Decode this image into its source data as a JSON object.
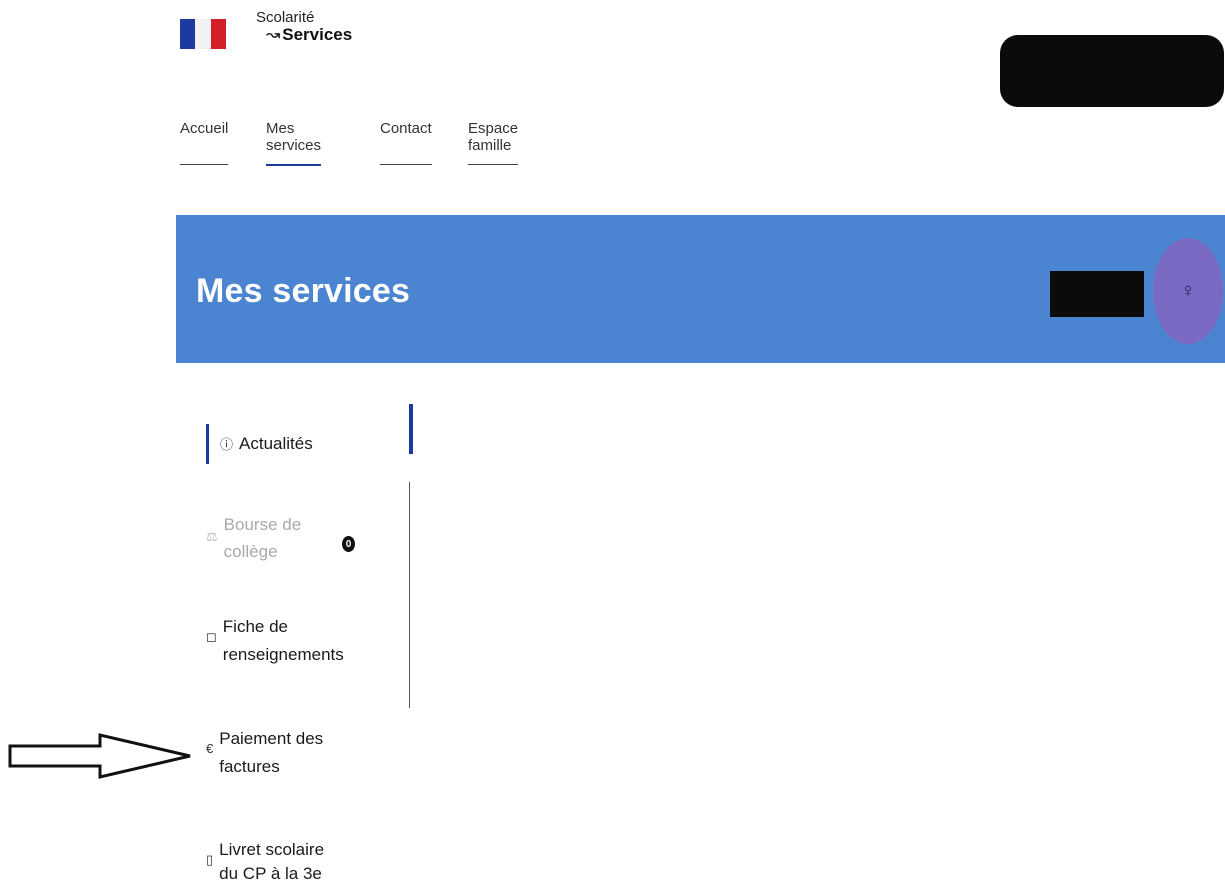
{
  "header": {
    "brand_line1": "Scolarité",
    "brand_line2": "Services",
    "brand_swirl": "↝"
  },
  "nav": [
    {
      "label": "Accueil",
      "active": false
    },
    {
      "label": "Mes services",
      "active": true
    },
    {
      "label": "Contact",
      "active": false
    },
    {
      "label": "Espace famille",
      "active": false
    }
  ],
  "banner": {
    "title": "Mes services",
    "avatar_glyph": "♀"
  },
  "sidebar": {
    "items": [
      {
        "label": "Actualités",
        "icon": "info-circle-icon",
        "glyph": "ⓘ",
        "active": true
      },
      {
        "label": "Bourse de collège",
        "icon": "scholarship-icon",
        "glyph": "⚖",
        "disabled": true,
        "badge": "0"
      },
      {
        "label": "Fiche de renseignements",
        "icon": "form-icon",
        "glyph": "◻"
      },
      {
        "label": "Paiement des factures",
        "icon": "euro-icon",
        "glyph": "€"
      },
      {
        "label": "Livret scolaire du CP à la 3e",
        "icon": "book-icon",
        "glyph": "▯"
      }
    ]
  },
  "colors": {
    "accent": "#1f3a9e",
    "banner": "#4b84d0",
    "avatar": "#7b6ac4"
  }
}
